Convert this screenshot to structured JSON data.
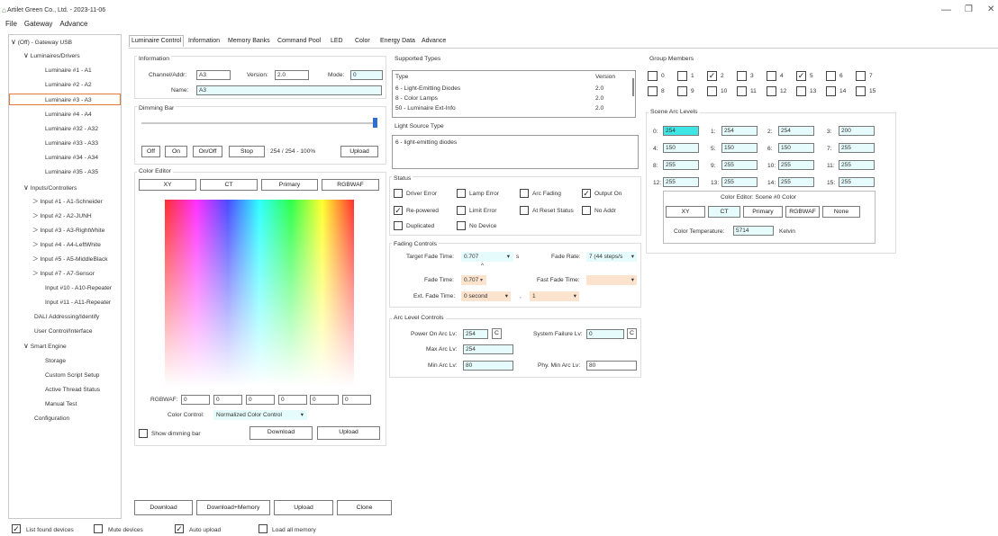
{
  "window": {
    "title": "Artilet Green Co., Ltd. - 2023-11-06",
    "min": "—",
    "restore": "❐",
    "close": "✕"
  },
  "menu": [
    "File",
    "Gateway",
    "Advance"
  ],
  "tree": {
    "root": "(Off) - Gateway USB",
    "luminaires_header": "Luminaires/Drivers",
    "luminaires": [
      "Luminaire #1 - A1",
      "Luminaire #2 - A2",
      "Luminaire #3 - A3",
      "Luminaire #4 - A4",
      "Luminaire #32 - A32",
      "Luminaire #33 - A33",
      "Luminaire #34 - A34",
      "Luminaire #35 - A35"
    ],
    "inputs_header": "Inputs/Controllers",
    "inputs": [
      "Input #1 - A1-Schneider",
      "Input #2 - A2-JUNH",
      "Input #3 - A3-RightWhite",
      "Input #4 - A4-LeftWhite",
      "Input #5 - A5-MiddleBlack",
      "Input #7 - A7-Sensor",
      "Input #10 - A10-Repeater",
      "Input #11 - A11-Repeater"
    ],
    "dali": "DALI Addressing/Identify",
    "user_control": "User Control/Interface",
    "smart_header": "Smart Engine",
    "smart": [
      "Storage",
      "Custom Script Setup",
      "Active Thread Status",
      "Manual Test"
    ],
    "configuration": "Configuration"
  },
  "tabs": [
    "Luminaire Control",
    "Information",
    "Memory Banks",
    "Command Pool",
    "LED",
    "Color",
    "Energy Data",
    "Advance"
  ],
  "information": {
    "title": "Information",
    "channel_label": "Channel/Addr:",
    "channel": "A3",
    "version_label": "Version:",
    "version": "2.0",
    "mode_label": "Mode:",
    "mode": "0",
    "name_label": "Name:",
    "name": "A3"
  },
  "dimming": {
    "title": "Dimming Bar",
    "level": 1.0,
    "off": "Off",
    "on": "On",
    "onoff": "On/Off",
    "stop": "Stop",
    "value": "254 / 254 - 100%",
    "upload": "Upload"
  },
  "color_editor": {
    "title": "Color Editor",
    "tabs": [
      "XY",
      "CT",
      "Primary",
      "RGBWAF"
    ],
    "rgbwaf_label": "RGBWAF:",
    "rgbwaf": [
      "0",
      "0",
      "0",
      "0",
      "0",
      "0"
    ],
    "control_label": "Color Control:",
    "control_value": "Normalized Color Control",
    "show_dimming": "Show dimming bar",
    "download": "Download",
    "upload": "Upload"
  },
  "bottom_buttons": [
    "Download",
    "Download+Memory",
    "Upload",
    "Clone"
  ],
  "supported": {
    "title": "Supported Types",
    "col_type": "Type",
    "col_version": "Version",
    "rows": [
      {
        "type": "6 - Light-Emitting Diodes",
        "version": "2.0"
      },
      {
        "type": "8 - Color Lamps",
        "version": "2.0"
      },
      {
        "type": "50 - Luminaire Ext-Info",
        "version": "2.0"
      }
    ]
  },
  "light_source": {
    "title": "Light Source Type",
    "value": "6 - light-emitting diodes"
  },
  "status": {
    "title": "Status",
    "items": [
      {
        "label": "Driver Error",
        "checked": false
      },
      {
        "label": "Lamp Error",
        "checked": false
      },
      {
        "label": "Arc Fading",
        "checked": false
      },
      {
        "label": "Output On",
        "checked": true
      },
      {
        "label": "Re-powered",
        "checked": true
      },
      {
        "label": "Limit Error",
        "checked": false
      },
      {
        "label": "At Reset Status",
        "checked": false
      },
      {
        "label": "No Addr",
        "checked": false
      },
      {
        "label": "Duplicated",
        "checked": false
      },
      {
        "label": "No Device",
        "checked": false
      }
    ]
  },
  "fading": {
    "title": "Fading Controls",
    "target_label": "Target Fade Time:",
    "target": "0.707",
    "target_unit": "s",
    "rate_label": "Fade Rate:",
    "rate": "7 (44 steps/s",
    "fade_label": "Fade Time:",
    "fade": "0.707",
    "fast_label": "Fast Fade Time:",
    "fast": "",
    "ext_label": "Ext. Fade Time:",
    "ext": "0 second",
    "ext_mult": "1",
    "caret": "^",
    "comma": ","
  },
  "arc": {
    "title": "Arc Level Controls",
    "poweron_label": "Power On Arc Lv:",
    "poweron": "254",
    "c": "C",
    "sysfail_label": "System Failure Lv:",
    "sysfail": "0",
    "max_label": "Max Arc Lv:",
    "max": "254",
    "min_label": "Min Arc Lv:",
    "min": "80",
    "phymin_label": "Phy. Min Arc Lv:",
    "phymin": "80"
  },
  "group": {
    "title": "Group Members",
    "items": [
      {
        "n": "0",
        "c": false
      },
      {
        "n": "1",
        "c": false
      },
      {
        "n": "2",
        "c": true
      },
      {
        "n": "3",
        "c": false
      },
      {
        "n": "4",
        "c": false
      },
      {
        "n": "5",
        "c": true
      },
      {
        "n": "6",
        "c": false
      },
      {
        "n": "7",
        "c": false
      },
      {
        "n": "8",
        "c": false
      },
      {
        "n": "9",
        "c": false
      },
      {
        "n": "10",
        "c": false
      },
      {
        "n": "11",
        "c": false
      },
      {
        "n": "12",
        "c": false
      },
      {
        "n": "13",
        "c": false
      },
      {
        "n": "14",
        "c": false
      },
      {
        "n": "15",
        "c": false
      }
    ]
  },
  "scene": {
    "title": "Scene Arc Levels",
    "items": [
      {
        "n": "0:",
        "v": "254"
      },
      {
        "n": "1:",
        "v": "254"
      },
      {
        "n": "2:",
        "v": "254"
      },
      {
        "n": "3:",
        "v": "200"
      },
      {
        "n": "4:",
        "v": "150"
      },
      {
        "n": "5:",
        "v": "150"
      },
      {
        "n": "6:",
        "v": "150"
      },
      {
        "n": "7:",
        "v": "255"
      },
      {
        "n": "8:",
        "v": "255"
      },
      {
        "n": "9:",
        "v": "255"
      },
      {
        "n": "10:",
        "v": "255"
      },
      {
        "n": "11:",
        "v": "255"
      },
      {
        "n": "12:",
        "v": "255"
      },
      {
        "n": "13:",
        "v": "255"
      },
      {
        "n": "14:",
        "v": "255"
      },
      {
        "n": "15:",
        "v": "255"
      }
    ],
    "color_title": "Color Editor: Scene #0 Color",
    "color_tabs": [
      "XY",
      "CT",
      "Primary",
      "RGBWAF",
      "None"
    ],
    "ct_label": "Color Temperature:",
    "ct": "5714",
    "ct_unit": "Kelvin"
  },
  "footer": [
    {
      "label": "List found devices",
      "checked": true
    },
    {
      "label": "Mute devices",
      "checked": false
    },
    {
      "label": "Auto upload",
      "checked": true
    },
    {
      "label": "Load all memory",
      "checked": false
    }
  ],
  "colors": {
    "accent": "#e07a3c",
    "cyan": "#3ee6e6",
    "light_cyan": "#e6fbfb",
    "peach": "#fce3cd",
    "slider": "#2f6fcf"
  }
}
